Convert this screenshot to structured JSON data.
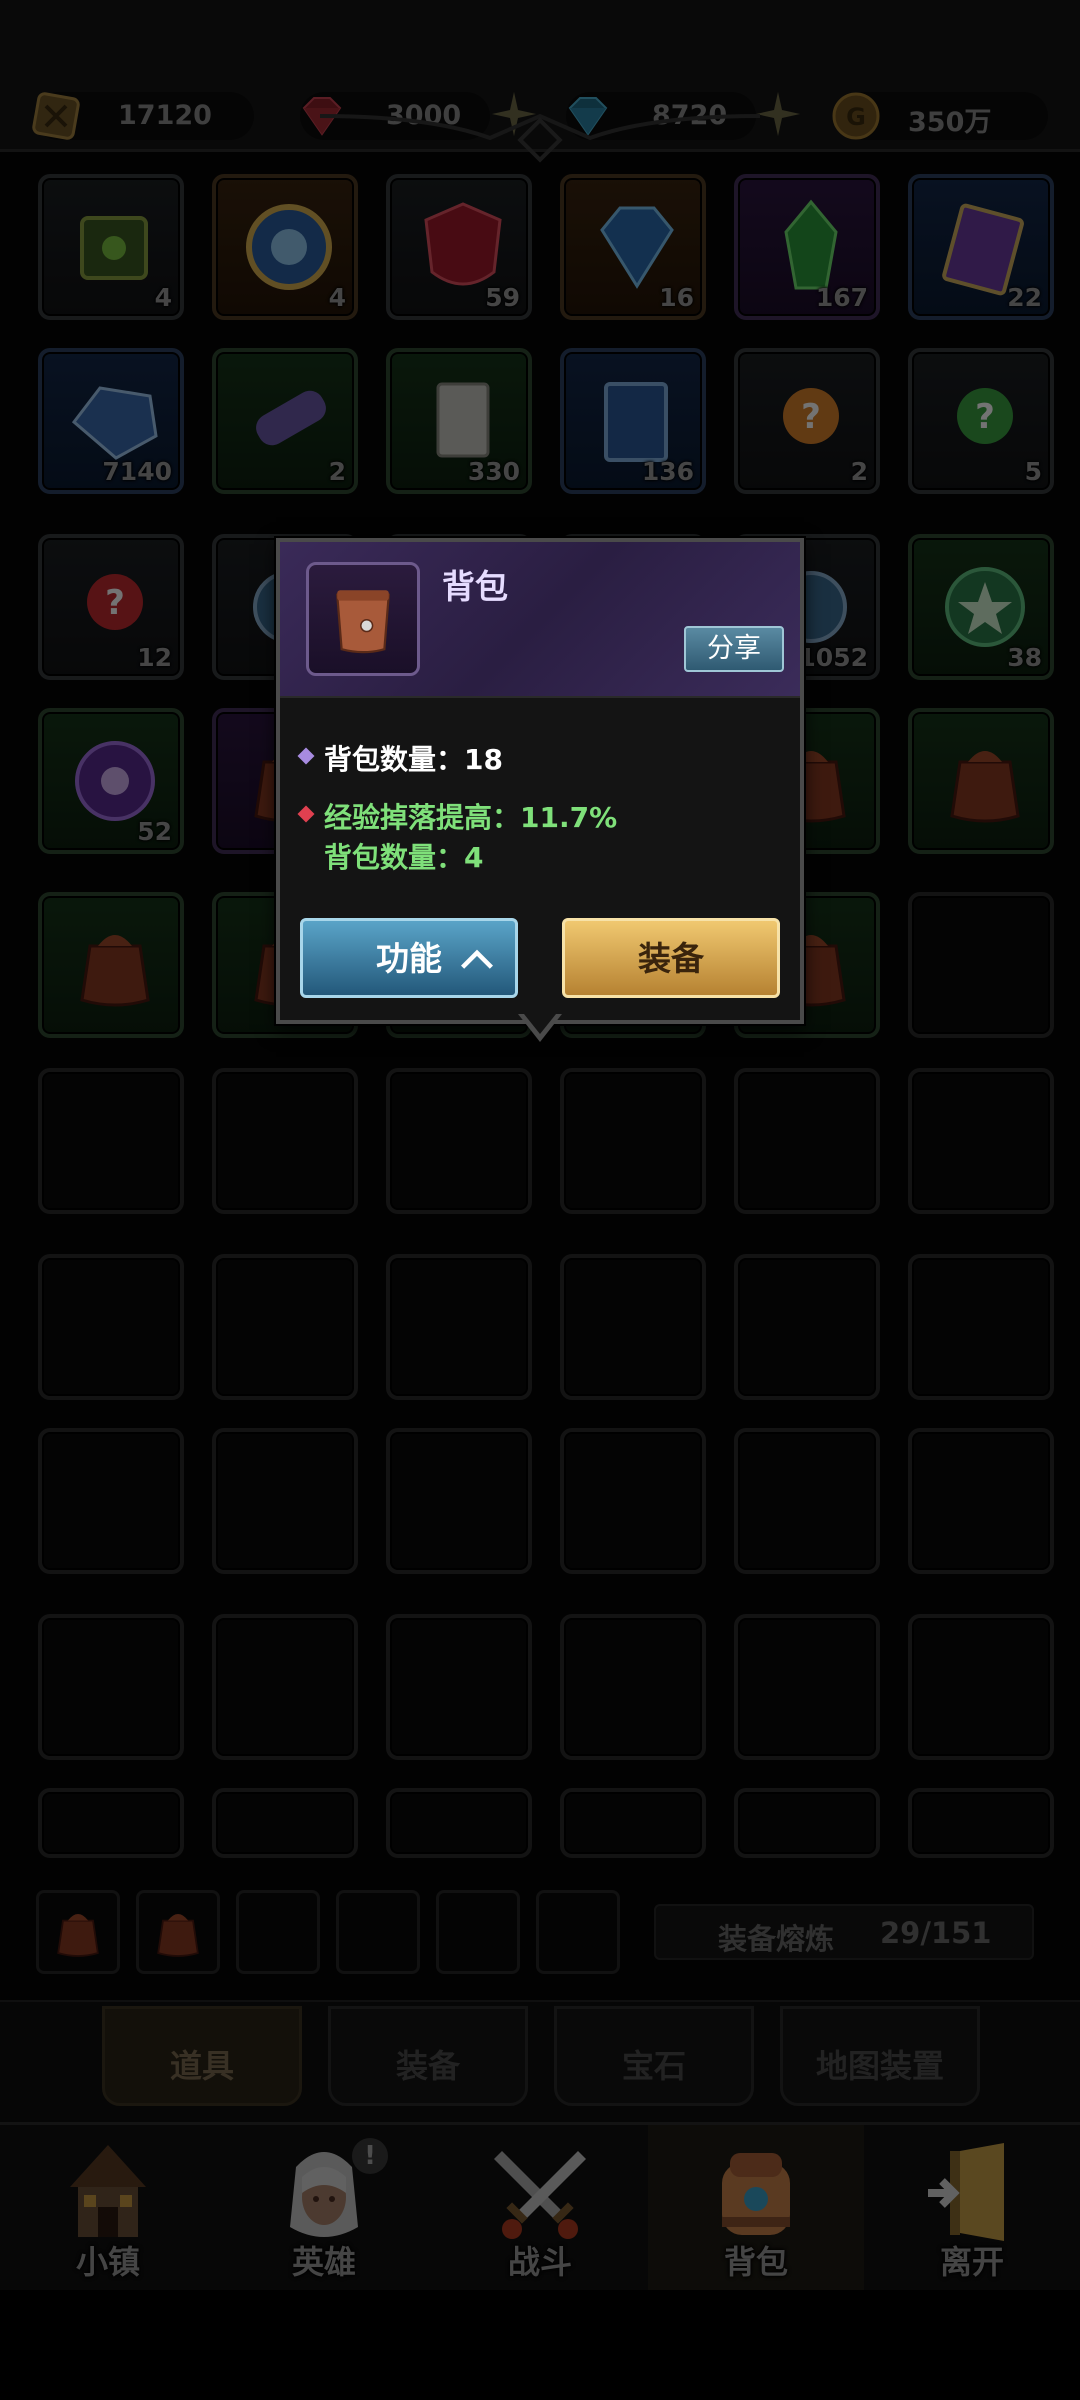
{
  "currencies": [
    {
      "name": "gold-chest",
      "value": "17120",
      "color": "#b08a3a"
    },
    {
      "name": "ruby",
      "value": "3000",
      "color": "#c0303a"
    },
    {
      "name": "diamond",
      "value": "8720",
      "color": "#3aa0c8"
    },
    {
      "name": "coin",
      "value": "350万",
      "color": "#b88a30"
    }
  ],
  "grid_items": [
    {
      "qty": "4",
      "rarity": "gray",
      "icon": "green-cube-icon"
    },
    {
      "qty": "4",
      "rarity": "orange",
      "icon": "blue-gear-orb-icon"
    },
    {
      "qty": "59",
      "rarity": "gray",
      "icon": "red-shield-icon"
    },
    {
      "qty": "16",
      "rarity": "orange",
      "icon": "blue-crystal-icon"
    },
    {
      "qty": "167",
      "rarity": "purple",
      "icon": "green-crystal-icon"
    },
    {
      "qty": "22",
      "rarity": "blue",
      "icon": "purple-book-icon"
    },
    {
      "qty": "7140",
      "rarity": "blue",
      "icon": "blue-gem-icon"
    },
    {
      "qty": "2",
      "rarity": "green",
      "icon": "purple-scroll-icon"
    },
    {
      "qty": "330",
      "rarity": "green",
      "icon": "paper-scroll-icon"
    },
    {
      "qty": "136",
      "rarity": "blue",
      "icon": "blue-book-icon"
    },
    {
      "qty": "2",
      "rarity": "gray",
      "icon": "orange-mystery-icon"
    },
    {
      "qty": "5",
      "rarity": "gray",
      "icon": "green-mystery-icon"
    },
    {
      "qty": "12",
      "rarity": "gray",
      "icon": "red-mystery-icon"
    },
    {
      "qty": "",
      "rarity": "gray",
      "icon": "blue-orb-icon"
    },
    {
      "qty": "",
      "rarity": "gray",
      "icon": "hidden-item-icon"
    },
    {
      "qty": "",
      "rarity": "gray",
      "icon": "hidden-item-icon"
    },
    {
      "qty": "1052",
      "rarity": "gray",
      "icon": "blue-orb-icon"
    },
    {
      "qty": "38",
      "rarity": "green",
      "icon": "green-star-disc-icon"
    },
    {
      "qty": "52",
      "rarity": "green",
      "icon": "purple-eye-disc-icon"
    },
    {
      "qty": "",
      "rarity": "purple",
      "icon": "bag-icon"
    },
    {
      "qty": "",
      "rarity": "gray",
      "icon": "hidden-item-icon"
    },
    {
      "qty": "",
      "rarity": "gray",
      "icon": "hidden-item-icon"
    },
    {
      "qty": "",
      "rarity": "green",
      "icon": "bag-icon"
    },
    {
      "qty": "",
      "rarity": "green",
      "icon": "bag-icon"
    },
    {
      "qty": "",
      "rarity": "green",
      "icon": "bag-icon"
    },
    {
      "qty": "",
      "rarity": "green",
      "icon": "bag-icon"
    },
    {
      "qty": "",
      "rarity": "green",
      "icon": "hidden-item-icon"
    },
    {
      "qty": "",
      "rarity": "green",
      "icon": "hidden-item-icon"
    },
    {
      "qty": "",
      "rarity": "green",
      "icon": "bag-icon"
    },
    {
      "qty": "",
      "rarity": "empty",
      "icon": ""
    }
  ],
  "equipped_bags": [
    {
      "icon": "bag-icon"
    },
    {
      "icon": "bag-icon"
    },
    {
      "icon": ""
    },
    {
      "icon": ""
    },
    {
      "icon": ""
    },
    {
      "icon": ""
    }
  ],
  "smelt": {
    "label": "装备熔炼",
    "count": "29/151"
  },
  "sub_tabs": [
    {
      "label": "道具",
      "active": true
    },
    {
      "label": "装备",
      "active": false
    },
    {
      "label": "宝石",
      "active": false
    },
    {
      "label": "地图装置",
      "active": false
    }
  ],
  "nav": [
    {
      "label": "小镇",
      "icon": "town-icon"
    },
    {
      "label": "英雄",
      "icon": "hero-icon"
    },
    {
      "label": "战斗",
      "icon": "crossed-swords-icon"
    },
    {
      "label": "背包",
      "icon": "backpack-icon",
      "active": true
    },
    {
      "label": "离开",
      "icon": "exit-door-icon"
    }
  ],
  "hero_badge": "!",
  "popup": {
    "title": "背包",
    "share_label": "分享",
    "stat_line": "背包数量：18",
    "bonus_line": "经验掉落提高：11.7%",
    "bonus_sub": "背包数量：4",
    "func_label": "功能",
    "equip_label": "装备",
    "colors": {
      "title": "#e6dcff",
      "stat": "#ffffff",
      "bonus": "#7fe07a",
      "bullet_stat": "#a78be0",
      "bullet_bonus": "#e04050"
    }
  }
}
